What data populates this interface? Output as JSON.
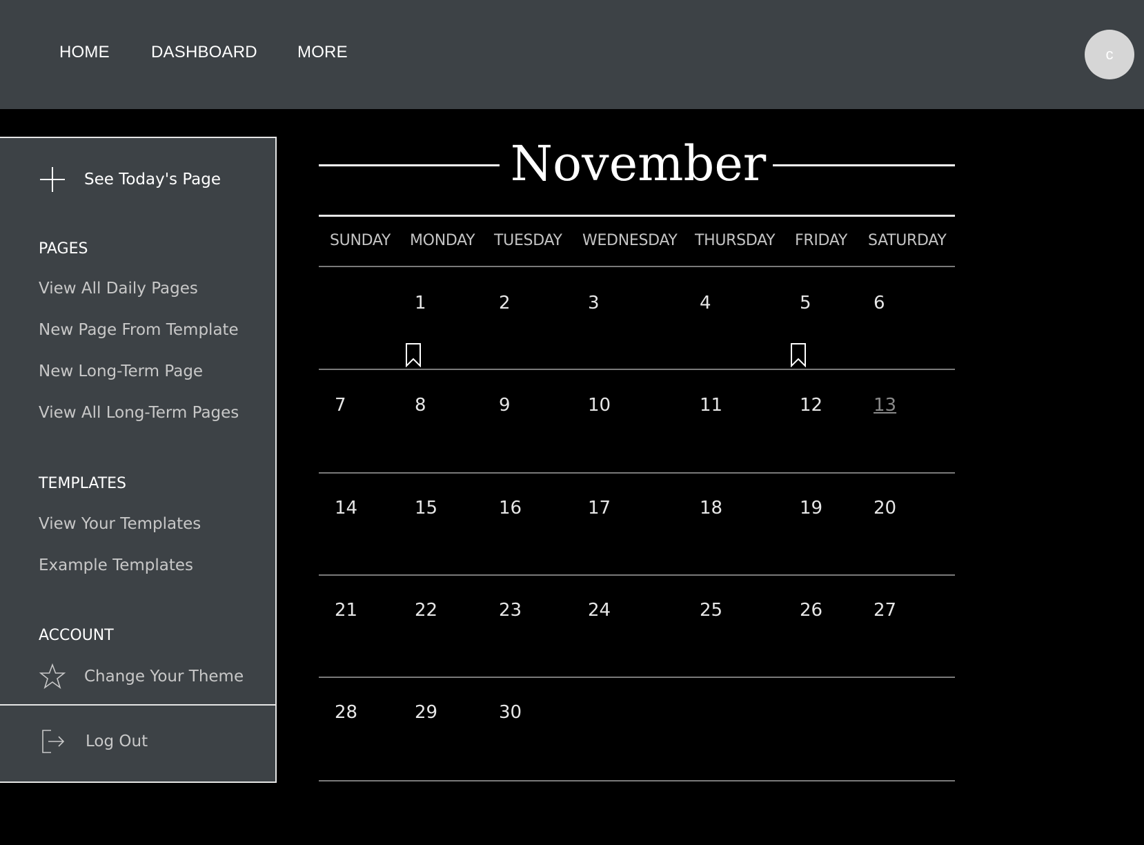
{
  "nav": {
    "home": "HOME",
    "dashboard": "DASHBOARD",
    "more": "MORE",
    "avatar_initial": "c"
  },
  "sidebar": {
    "today_label": "See Today's Page",
    "pages_heading": "PAGES",
    "pages_links": [
      "View All Daily Pages",
      "New Page From Template",
      "New Long-Term Page",
      "View All Long-Term Pages"
    ],
    "templates_heading": "TEMPLATES",
    "templates_links": [
      "View Your Templates",
      "Example Templates"
    ],
    "account_heading": "ACCOUNT",
    "theme_label": "Change Your Theme",
    "logout_label": "Log Out"
  },
  "calendar": {
    "month": "November",
    "weekdays": [
      "SUNDAY",
      "MONDAY",
      "TUESDAY",
      "WEDNESDAY",
      "THURSDAY",
      "FRIDAY",
      "SATURDAY"
    ],
    "weeks": [
      [
        "",
        "1",
        "2",
        "3",
        "4",
        "5",
        "6"
      ],
      [
        "7",
        "8",
        "9",
        "10",
        "11",
        "12",
        "13"
      ],
      [
        "14",
        "15",
        "16",
        "17",
        "18",
        "19",
        "20"
      ],
      [
        "21",
        "22",
        "23",
        "24",
        "25",
        "26",
        "27"
      ],
      [
        "28",
        "29",
        "30",
        "",
        "",
        "",
        ""
      ]
    ],
    "today": "13",
    "bookmarked_days": [
      "1",
      "5"
    ]
  },
  "colors": {
    "topbar": "#3d4246",
    "sidebar": "#3d4246",
    "background": "#000000",
    "avatar": "#d6d6d6"
  }
}
